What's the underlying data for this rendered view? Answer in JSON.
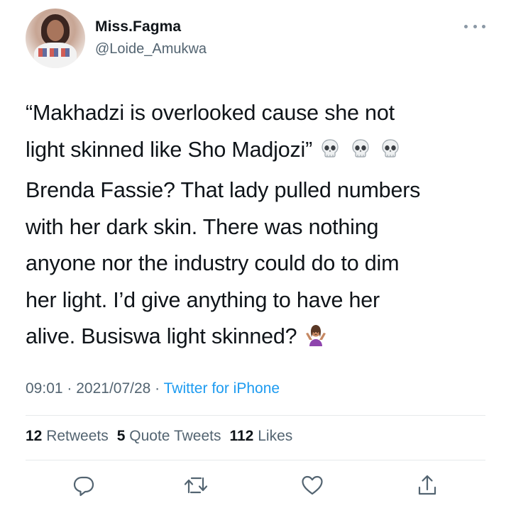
{
  "user": {
    "display_name": "Miss.Fagma",
    "handle": "@Loide_Amukwa",
    "avatar_icon": "profile-photo"
  },
  "tweet": {
    "line1": "“Makhadzi is overlooked cause she not",
    "line2": "light skinned like Sho Madjozi”",
    "line3": "Brenda Fassie? That lady pulled numbers",
    "line4": "with her dark skin. There was nothing",
    "line5": "anyone nor the industry could do to dim",
    "line6": "her light. I’d give anything to have her",
    "line7": "alive. Busiswa light skinned?",
    "emojis": [
      "skull",
      "skull",
      "skull",
      "person-shrugging"
    ]
  },
  "meta": {
    "time": "09:01",
    "sep1": " · ",
    "date": "2021/07/28",
    "sep2": " · ",
    "source": "Twitter for iPhone"
  },
  "stats": {
    "retweets_count": "12",
    "retweets_label": "Retweets",
    "quotes_count": "5",
    "quotes_label": "Quote Tweets",
    "likes_count": "112",
    "likes_label": "Likes"
  },
  "actions": [
    "reply-icon",
    "retweet-icon",
    "like-icon",
    "share-icon"
  ],
  "colors": {
    "text": "#0f1419",
    "secondary": "#536471",
    "link": "#1d9bf0",
    "divider": "#e6e9eb"
  }
}
